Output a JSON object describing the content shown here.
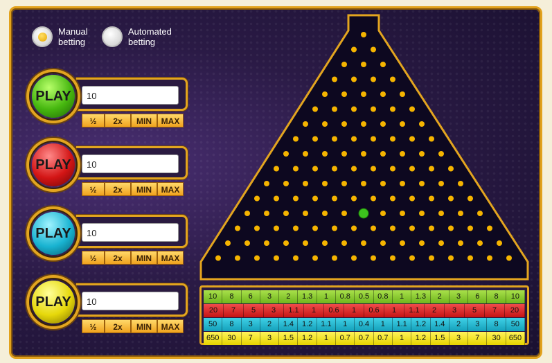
{
  "mode": {
    "manual_label_1": "Manual",
    "manual_label_2": "betting",
    "auto_label_1": "Automated",
    "auto_label_2": "betting",
    "selected": "manual"
  },
  "colors": {
    "accent": "#e3a51f",
    "background": "#2a1a45",
    "peg": "#f5b400",
    "ball": "#3cc21e"
  },
  "play_rows": [
    {
      "label": "PLAY",
      "color": "green",
      "value": "10"
    },
    {
      "label": "PLAY",
      "color": "red",
      "value": "10"
    },
    {
      "label": "PLAY",
      "color": "cyan",
      "value": "10"
    },
    {
      "label": "PLAY",
      "color": "yellow",
      "value": "10"
    }
  ],
  "bet_buttons": {
    "half": "½",
    "double": "2x",
    "min": "MIN",
    "max": "MAX"
  },
  "multipliers": {
    "green": [
      "10",
      "8",
      "6",
      "3",
      "2",
      "1.3",
      "1",
      "0.8",
      "0.5",
      "0.8",
      "1",
      "1.3",
      "2",
      "3",
      "6",
      "8",
      "10"
    ],
    "red": [
      "20",
      "7",
      "5",
      "3",
      "1.1",
      "1",
      "0.6",
      "1",
      "0.6",
      "1",
      "1.1",
      "2",
      "3",
      "5",
      "7",
      "20"
    ],
    "cyan": [
      "50",
      "8",
      "3",
      "2",
      "1.4",
      "1.2",
      "1.1",
      "1",
      "0.4",
      "1",
      "1.1",
      "1.2",
      "1.4",
      "2",
      "3",
      "8",
      "50"
    ],
    "yellow": [
      "650",
      "30",
      "7",
      "3",
      "1.5",
      "1.2",
      "1",
      "0.7",
      "0.7",
      "0.7",
      "1",
      "1.2",
      "1.5",
      "3",
      "7",
      "30",
      "650"
    ]
  },
  "board": {
    "peg_rows": 16,
    "ball_row": 12,
    "ball_index": 6
  }
}
